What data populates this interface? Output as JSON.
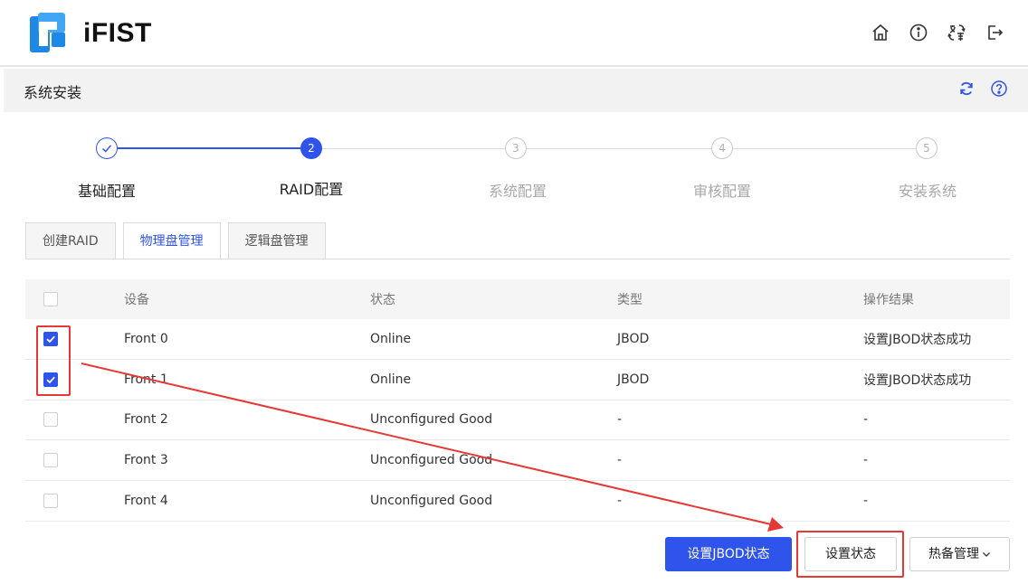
{
  "header": {
    "brand": "iFIST",
    "icons": [
      "home-icon",
      "info-icon",
      "language-icon",
      "logout-icon"
    ]
  },
  "subheader": {
    "title": "系统安装",
    "icons": [
      "refresh-icon",
      "help-icon"
    ]
  },
  "steps": [
    {
      "label": "基础配置",
      "number": "",
      "status": "done"
    },
    {
      "label": "RAID配置",
      "number": "2",
      "status": "current"
    },
    {
      "label": "系统配置",
      "number": "3",
      "status": "todo"
    },
    {
      "label": "审核配置",
      "number": "4",
      "status": "todo"
    },
    {
      "label": "安装系统",
      "number": "5",
      "status": "todo"
    }
  ],
  "tabs": [
    {
      "label": "创建RAID",
      "active": false
    },
    {
      "label": "物理盘管理",
      "active": true
    },
    {
      "label": "逻辑盘管理",
      "active": false
    }
  ],
  "table": {
    "headers": {
      "device": "设备",
      "state": "状态",
      "type": "类型",
      "result": "操作结果"
    },
    "rows": [
      {
        "device": "Front 0",
        "state": "Online",
        "type": "JBOD",
        "result": "设置JBOD状态成功",
        "checked": true
      },
      {
        "device": "Front 1",
        "state": "Online",
        "type": "JBOD",
        "result": "设置JBOD状态成功",
        "checked": true
      },
      {
        "device": "Front 2",
        "state": "Unconfigured Good",
        "type": "-",
        "result": "-",
        "checked": false
      },
      {
        "device": "Front 3",
        "state": "Unconfigured Good",
        "type": "-",
        "result": "-",
        "checked": false
      },
      {
        "device": "Front 4",
        "state": "Unconfigured Good",
        "type": "-",
        "result": "-",
        "checked": false
      }
    ]
  },
  "buttons": {
    "set_jbod": "设置JBOD状态",
    "set_state": "设置状态",
    "hotspare": "热备管理"
  },
  "colors": {
    "accent": "#2f54eb",
    "annotation": "#e53935"
  }
}
